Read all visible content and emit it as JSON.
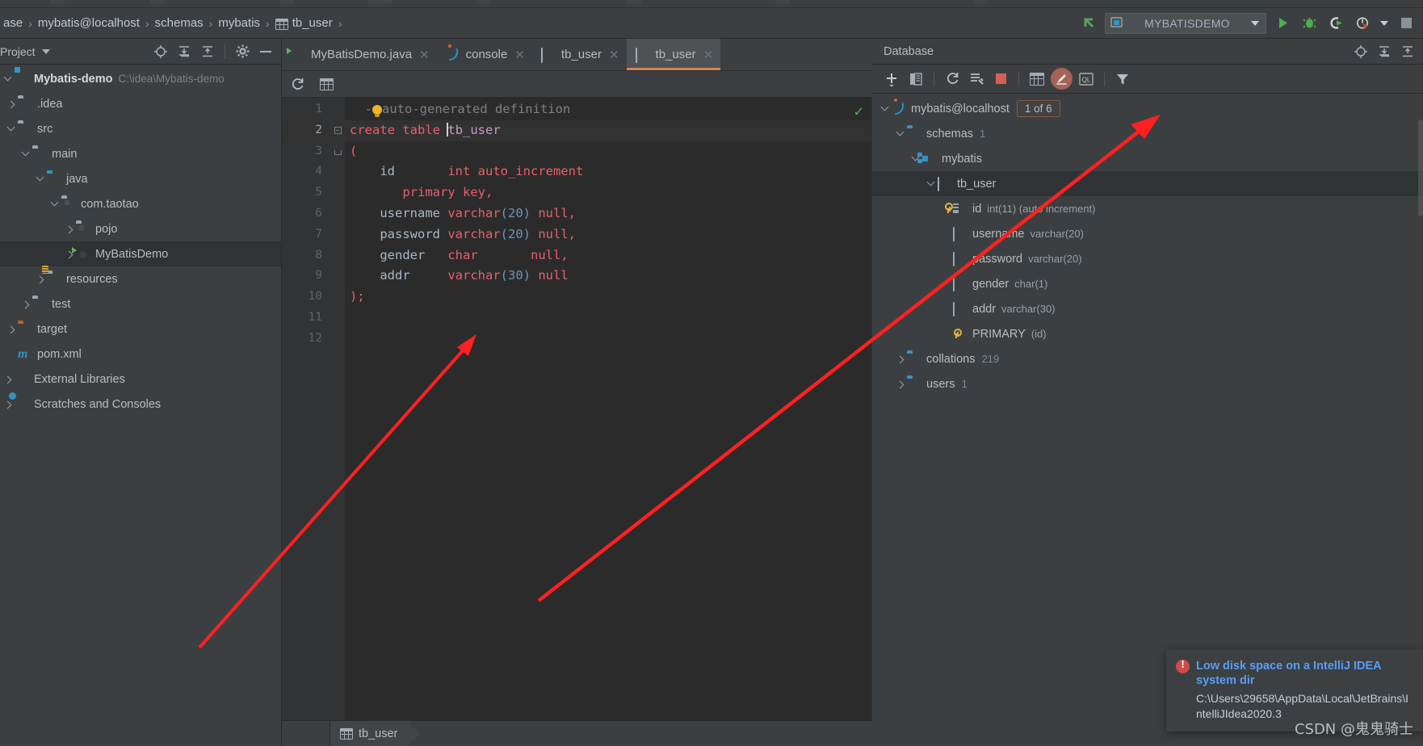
{
  "window": {
    "run_config": "MYBATISDEMO"
  },
  "breadcrumb": {
    "items": [
      {
        "label": "ase",
        "icon": "none"
      },
      {
        "label": "mybatis@localhost",
        "icon": "none"
      },
      {
        "label": "schemas",
        "icon": "none"
      },
      {
        "label": "mybatis",
        "icon": "none"
      },
      {
        "label": "tb_user",
        "icon": "table-icon"
      }
    ],
    "separator": "›"
  },
  "toolbar_right": {
    "back_icon": "back-arrow-icon",
    "config_icon": "run-config-icon",
    "dropdown_icon": "chevron-down-icon",
    "run_icon": "run-icon",
    "debug_icon": "debug-icon",
    "coverage_icon": "run-with-coverage-icon",
    "profile_icon": "profiler-icon",
    "profile_dropdown_icon": "chevron-down-icon",
    "stop_icon": "stop-icon"
  },
  "project_panel": {
    "title": "Project",
    "dropdown_icon": "chevron-down-icon",
    "tools": [
      {
        "name": "locate-icon"
      },
      {
        "name": "expand-all-icon"
      },
      {
        "name": "collapse-all-icon"
      },
      {
        "name": "settings-gear-icon"
      },
      {
        "name": "hide-panel-icon"
      }
    ],
    "tree": [
      {
        "label": "Mybatis-demo",
        "path": "C:\\idea\\Mybatis-demo",
        "icon": "module-icon",
        "indent": 0,
        "twisty": "down",
        "bold": true,
        "selected": false
      },
      {
        "label": ".idea",
        "path": "",
        "icon": "folder-icon",
        "indent": 1,
        "twisty": "right",
        "bold": false,
        "selected": false
      },
      {
        "label": "src",
        "path": "",
        "icon": "folder-icon",
        "indent": 1,
        "twisty": "down",
        "bold": false,
        "selected": false
      },
      {
        "label": "main",
        "path": "",
        "icon": "folder-icon",
        "indent": 2,
        "twisty": "down",
        "bold": false,
        "selected": false
      },
      {
        "label": "java",
        "path": "",
        "icon": "folder-blue-icon",
        "indent": 3,
        "twisty": "down",
        "bold": false,
        "selected": false
      },
      {
        "label": "com.taotao",
        "path": "",
        "icon": "package-icon",
        "indent": 4,
        "twisty": "down",
        "bold": false,
        "selected": false
      },
      {
        "label": "pojo",
        "path": "",
        "icon": "package-icon",
        "indent": 5,
        "twisty": "right",
        "bold": false,
        "selected": false
      },
      {
        "label": "MyBatisDemo",
        "path": "",
        "icon": "java-class-icon",
        "indent": 5,
        "twisty": "right",
        "bold": false,
        "selected": true
      },
      {
        "label": "resources",
        "path": "",
        "icon": "resources-folder-icon",
        "indent": 3,
        "twisty": "right",
        "bold": false,
        "selected": false
      },
      {
        "label": "test",
        "path": "",
        "icon": "folder-icon",
        "indent": 2,
        "twisty": "right",
        "bold": false,
        "selected": false
      },
      {
        "label": "target",
        "path": "",
        "icon": "folder-orange-icon",
        "indent": 1,
        "twisty": "right",
        "bold": false,
        "selected": false
      },
      {
        "label": "pom.xml",
        "path": "",
        "icon": "maven-icon",
        "indent": 1,
        "twisty": "none",
        "bold": false,
        "selected": false
      },
      {
        "label": "External Libraries",
        "path": "",
        "icon": "libraries-icon",
        "indent": 0,
        "twisty": "right",
        "bold": false,
        "selected": false
      },
      {
        "label": "Scratches and Consoles",
        "path": "",
        "icon": "scratches-icon",
        "indent": 0,
        "twisty": "right",
        "bold": false,
        "selected": false
      }
    ]
  },
  "editor": {
    "tabs": [
      {
        "label": "MyBatisDemo.java",
        "icon": "java-class-icon",
        "active": false,
        "close_icon": "close-icon"
      },
      {
        "label": "console",
        "icon": "mysql-icon",
        "active": false,
        "close_icon": "close-icon"
      },
      {
        "label": "tb_user",
        "icon": "table-icon",
        "active": false,
        "close_icon": "close-icon"
      },
      {
        "label": "tb_user",
        "icon": "table-icon",
        "active": true,
        "close_icon": "close-icon"
      }
    ],
    "toolbar": [
      {
        "name": "refresh-icon"
      },
      {
        "name": "table-view-icon"
      }
    ],
    "inspection_status_icon": "inspection-ok-icon",
    "lines": [
      {
        "n": "1",
        "current": false,
        "fold": "none"
      },
      {
        "n": "2",
        "current": true,
        "fold": "box"
      },
      {
        "n": "3",
        "current": false,
        "fold": "box"
      },
      {
        "n": "4",
        "current": false,
        "fold": "none"
      },
      {
        "n": "5",
        "current": false,
        "fold": "none"
      },
      {
        "n": "6",
        "current": false,
        "fold": "none"
      },
      {
        "n": "7",
        "current": false,
        "fold": "none"
      },
      {
        "n": "8",
        "current": false,
        "fold": "none"
      },
      {
        "n": "9",
        "current": false,
        "fold": "none"
      },
      {
        "n": "10",
        "current": false,
        "fold": "none"
      },
      {
        "n": "11",
        "current": false,
        "fold": "none"
      },
      {
        "n": "12",
        "current": false,
        "fold": "none"
      }
    ],
    "code": {
      "l1_comment": "auto-generated definition",
      "l2_kw1": "create",
      "l2_kw2": "table",
      "l2_name": "tb_user",
      "l3": "(",
      "l4_col": "id",
      "l4_type": "int auto_increment",
      "l5": "primary key,",
      "l6_col": "username",
      "l6_type": "varchar",
      "l6_len": "(20)",
      "l6_null": "null,",
      "l7_col": "password",
      "l7_type": "varchar",
      "l7_len": "(20)",
      "l7_null": "null,",
      "l8_col": "gender",
      "l8_type": "char",
      "l8_null": "null,",
      "l9_col": "addr",
      "l9_type": "varchar",
      "l9_len": "(30)",
      "l9_null": "null",
      "l10": ");"
    },
    "status_breadcrumb": {
      "label": "tb_user",
      "icon": "table-icon"
    }
  },
  "database_panel": {
    "title": "Database",
    "header_tools": [
      {
        "name": "locate-icon"
      },
      {
        "name": "expand-all-icon"
      },
      {
        "name": "collapse-all-icon"
      }
    ],
    "toolbar": [
      {
        "name": "add-new-icon"
      },
      {
        "name": "duplicate-icon"
      },
      {
        "name": "refresh-icon"
      },
      {
        "name": "run-sql-script-icon"
      },
      {
        "name": "stop-icon"
      },
      {
        "name": "table-editor-icon"
      },
      {
        "name": "modify-table-icon"
      },
      {
        "name": "query-console-icon"
      },
      {
        "name": "filter-icon"
      }
    ],
    "tree": [
      {
        "label": "mybatis@localhost",
        "detail": "",
        "badge": "1 of 6",
        "icon": "mysql-icon",
        "indent": 0,
        "twisty": "down",
        "selected": false
      },
      {
        "label": "schemas",
        "detail": "1",
        "badge": "",
        "icon": "folder-blue-icon",
        "indent": 1,
        "twisty": "down",
        "selected": false
      },
      {
        "label": "mybatis",
        "detail": "",
        "badge": "",
        "icon": "schema-icon",
        "indent": 2,
        "twisty": "down",
        "selected": false
      },
      {
        "label": "tb_user",
        "detail": "",
        "badge": "",
        "icon": "table-icon",
        "indent": 3,
        "twisty": "down",
        "selected": true
      },
      {
        "label": "id",
        "detail": "int(11) (auto increment)",
        "badge": "",
        "icon": "column-pk-icon",
        "indent": 4,
        "twisty": "none",
        "selected": false
      },
      {
        "label": "username",
        "detail": "varchar(20)",
        "badge": "",
        "icon": "column-icon",
        "indent": 4,
        "twisty": "none",
        "selected": false
      },
      {
        "label": "password",
        "detail": "varchar(20)",
        "badge": "",
        "icon": "column-icon",
        "indent": 4,
        "twisty": "none",
        "selected": false
      },
      {
        "label": "gender",
        "detail": "char(1)",
        "badge": "",
        "icon": "column-icon",
        "indent": 4,
        "twisty": "none",
        "selected": false
      },
      {
        "label": "addr",
        "detail": "varchar(30)",
        "badge": "",
        "icon": "column-icon",
        "indent": 4,
        "twisty": "none",
        "selected": false
      },
      {
        "label": "PRIMARY",
        "detail": "(id)",
        "badge": "",
        "icon": "key-icon",
        "indent": 4,
        "twisty": "none",
        "selected": false
      },
      {
        "label": "collations",
        "detail": "219",
        "badge": "",
        "icon": "folder-blue-icon",
        "indent": 1,
        "twisty": "right",
        "selected": false
      },
      {
        "label": "users",
        "detail": "1",
        "badge": "",
        "icon": "folder-blue-icon",
        "indent": 1,
        "twisty": "right",
        "selected": false
      }
    ]
  },
  "notification": {
    "icon": "error-icon",
    "title": "Low disk space on a IntelliJ IDEA system dir",
    "body": "C:\\Users\\29658\\AppData\\Local\\JetBrains\\IntelliJIdea2020.3"
  },
  "watermark": "CSDN @鬼鬼骑士",
  "colors": {
    "accent_orange": "#d2864f",
    "keyword": "#cc7832",
    "sql_red": "#e8606c",
    "number_blue": "#6897bb",
    "link_blue": "#589df6",
    "arrow_red": "#ff2020"
  }
}
